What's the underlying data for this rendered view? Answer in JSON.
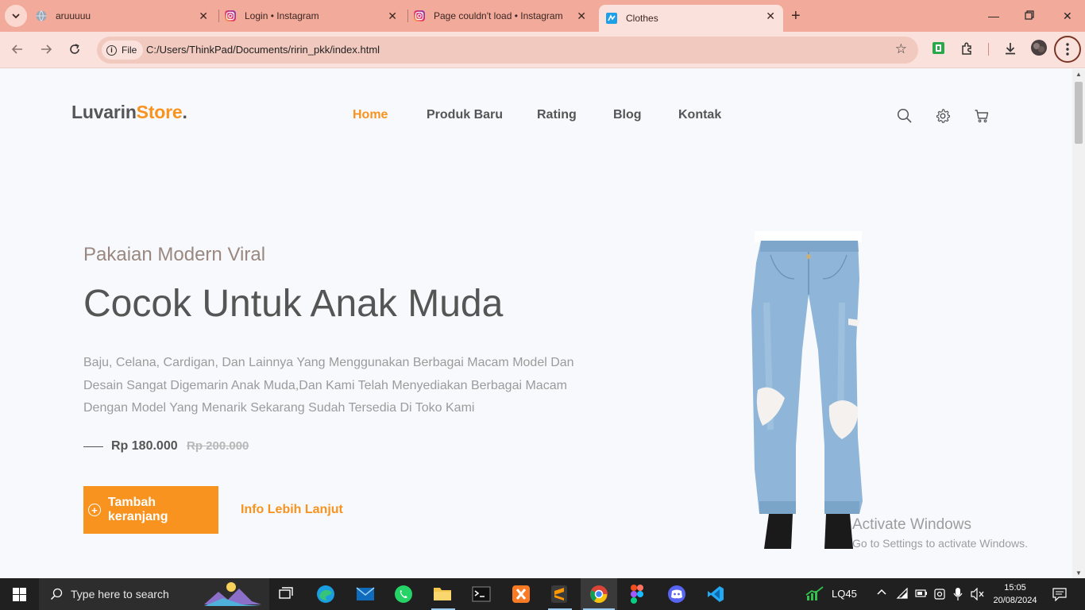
{
  "browser": {
    "tabs": [
      {
        "label": "aruuuuu",
        "active": false
      },
      {
        "label": "Login • Instagram",
        "active": false
      },
      {
        "label": "Page couldn't load • Instagram",
        "active": false
      },
      {
        "label": "Clothes",
        "active": true
      }
    ],
    "address": {
      "chip_label": "File",
      "url": "C:/Users/ThinkPad/Documents/ririn_pkk/index.html"
    }
  },
  "site": {
    "logo": {
      "part1": "Luvarin",
      "part2": "Store",
      "part3": "."
    },
    "nav": [
      "Home",
      "Produk Baru",
      "Rating",
      "Blog",
      "Kontak"
    ],
    "active_nav": "Home",
    "icons": [
      "search-icon",
      "gear-icon",
      "cart-icon"
    ],
    "accent_color": "#f7931e"
  },
  "hero": {
    "subtitle": "Pakaian Modern Viral",
    "headline": "Cocok Untuk Anak Muda",
    "description": "Baju, Celana, Cardigan, Dan Lainnya Yang Menggunakan Berbagai Macam Model Dan Desain Sangat Digemarin Anak Muda,Dan Kami Telah Menyediakan Berbagai Macam Dengan Model Yang Menarik Sekarang Sudah Tersedia Di Toko Kami",
    "price": "Rp 180.000",
    "old_price": "Rp 200.000",
    "cart_button": "Tambah keranjang",
    "info_link": "Info Lebih Lanjut"
  },
  "watermark": {
    "line1": "Activate Windows",
    "line2": "Go to Settings to activate Windows."
  },
  "taskbar": {
    "search_placeholder": "Type here to search",
    "stock_label": "LQ45",
    "time": "15:05",
    "date": "20/08/2024"
  }
}
